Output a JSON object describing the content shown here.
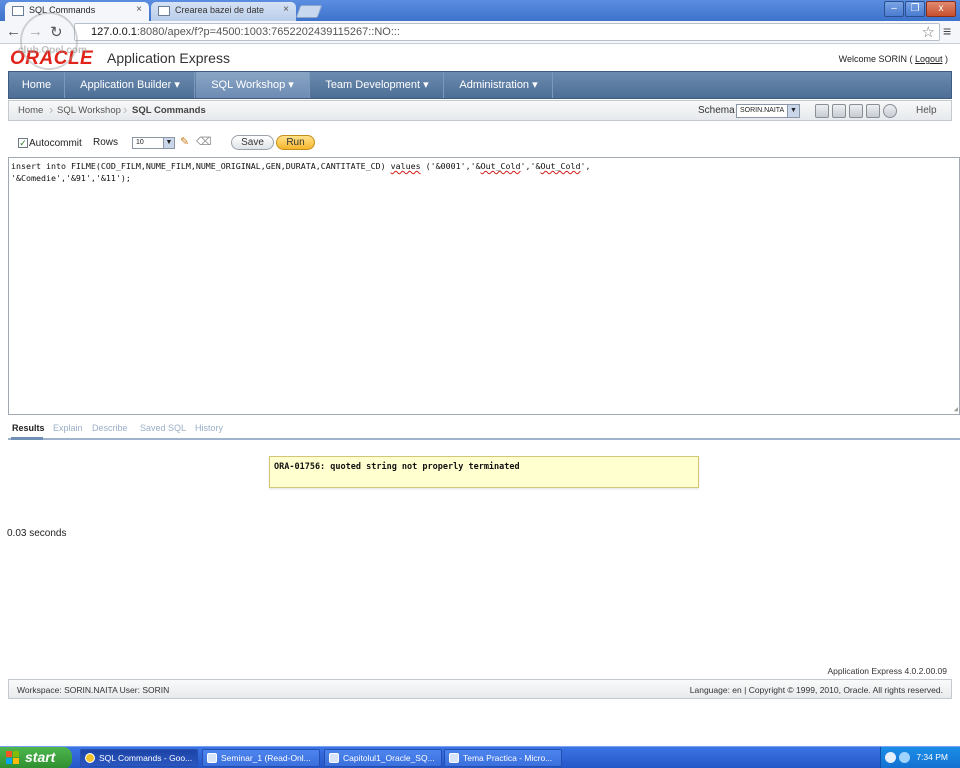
{
  "browser": {
    "tabs": [
      {
        "label": "SQL Commands",
        "active": true
      },
      {
        "label": "Crearea bazei de date",
        "active": false
      }
    ],
    "close_glyph": "×",
    "url_host": "127.0.0.1",
    "url_rest": ":8080/apex/f?p=4500:1003:7652202439115267::NO:::",
    "window_buttons": {
      "minimize": "–",
      "restore": "❐",
      "close": "x"
    }
  },
  "watermark": {
    "text": "club.Opel.com"
  },
  "apex": {
    "logo": "ORACLE",
    "app_title": "Application Express",
    "welcome": "Welcome SORIN",
    "logout": "Logout",
    "nav": [
      {
        "label": "Home"
      },
      {
        "label": "Application Builder ▾"
      },
      {
        "label": "SQL Workshop ▾"
      },
      {
        "label": "Team Development ▾"
      },
      {
        "label": "Administration ▾"
      }
    ],
    "breadcrumb": [
      "Home",
      "SQL Workshop",
      "SQL Commands"
    ],
    "schema_label": "Schema",
    "schema_value": "SORIN.NAITA",
    "help": "Help"
  },
  "toolbar": {
    "autocommit_label": "Autocommit",
    "autocommit_checked": "✓",
    "rows_label": "Rows",
    "rows_value": "10",
    "save_label": "Save",
    "run_label": "Run"
  },
  "editor": {
    "line1_a": "insert into FILME(COD_FILM,NUME_FILM,NUME_ORIGINAL,GEN,DURATA,CANTITATE_CD) ",
    "line1_values": "values",
    "line1_b": " ('&0001','&",
    "line1_sq1": "Out_Cold",
    "line1_c": "','&",
    "line1_sq2": "Out_Cold",
    "line1_d": "',",
    "line2": "'&Comedie','&91','&11');"
  },
  "results": {
    "tabs": [
      {
        "label": "Results"
      },
      {
        "label": "Explain"
      },
      {
        "label": "Describe"
      },
      {
        "label": "Saved SQL"
      },
      {
        "label": "History"
      }
    ],
    "error": "ORA-01756: quoted string not properly terminated",
    "elapsed": "0.03 seconds"
  },
  "footer": {
    "version": "Application Express 4.0.2.00.09",
    "left": "Workspace: SORIN.NAITA User: SORIN",
    "right": "Language: en | Copyright © 1999, 2010, Oracle. All rights reserved."
  },
  "taskbar": {
    "start": "start",
    "items": [
      {
        "label": "SQL Commands - Goo..."
      },
      {
        "label": "Seminar_1 (Read-Onl..."
      },
      {
        "label": "Capitolul1_Oracle_SQ..."
      },
      {
        "label": "Tema Practica - Micro..."
      }
    ],
    "clock": "7:34 PM"
  },
  "colors": {
    "oracle_red": "#e2231a",
    "nav_blue": "#4d6e96",
    "run_orange": "#f7b52b",
    "error_bg": "#ffffcf",
    "taskbar_blue": "#2456c8",
    "start_green": "#2e8e2e"
  }
}
